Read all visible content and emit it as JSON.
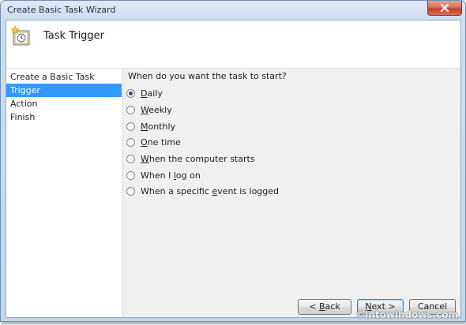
{
  "window": {
    "title": "Create Basic Task Wizard",
    "close_glyph": "X"
  },
  "header": {
    "icon": "scheduled-task-icon",
    "title": "Task Trigger"
  },
  "sidebar": {
    "items": [
      {
        "label": "Create a Basic Task",
        "active": false
      },
      {
        "label": "Trigger",
        "active": true
      },
      {
        "label": "Action",
        "active": false
      },
      {
        "label": "Finish",
        "active": false
      }
    ]
  },
  "content": {
    "question": "When do you want the task to start?",
    "options": [
      {
        "pre": "",
        "mnemonic": "D",
        "post": "aily",
        "checked": true
      },
      {
        "pre": "",
        "mnemonic": "W",
        "post": "eekly",
        "checked": false
      },
      {
        "pre": "",
        "mnemonic": "M",
        "post": "onthly",
        "checked": false
      },
      {
        "pre": "",
        "mnemonic": "O",
        "post": "ne time",
        "checked": false
      },
      {
        "pre": "",
        "mnemonic": "W",
        "post": "hen the computer starts",
        "checked": false
      },
      {
        "pre": "When I ",
        "mnemonic": "l",
        "post": "og on",
        "checked": false
      },
      {
        "pre": "When a specific ",
        "mnemonic": "e",
        "post": "vent is logged",
        "checked": false
      }
    ]
  },
  "buttons": {
    "back": {
      "pre": "< ",
      "mnemonic": "B",
      "post": "ack"
    },
    "next": {
      "pre": "",
      "mnemonic": "N",
      "post": "ext >"
    },
    "cancel": "Cancel"
  },
  "watermark": "©intowindows.com",
  "colors": {
    "selection": "#3399ff",
    "window_frame": "#cfdeef",
    "close_button": "#c2402a"
  }
}
